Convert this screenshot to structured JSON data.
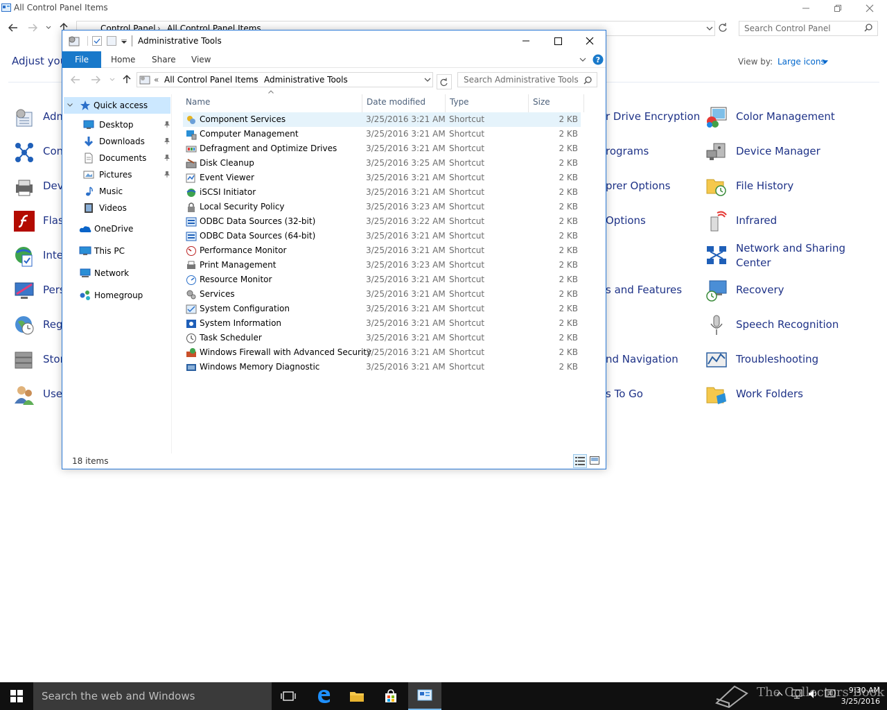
{
  "cp": {
    "title": "All Control Panel Items",
    "breadcrumb": [
      "Control Panel",
      "All Control Panel Items"
    ],
    "search_placeholder": "Search Control Panel",
    "adjust_label": "Adjust your computer's settings",
    "view_by_label": "View by:",
    "view_by_value": "Large icons",
    "left_items": [
      "Adm",
      "Con",
      "Dev",
      "Flas",
      "Inte",
      "Pers",
      "Reg",
      "Stor",
      "Use"
    ],
    "middle_items": [
      "r Drive Encryption",
      "rograms",
      "prer Options",
      "Options",
      "s and Features",
      "nd Navigation",
      "s To Go"
    ],
    "right_items": [
      "Color Management",
      "Device Manager",
      "File History",
      "Infrared",
      "Network and Sharing Center",
      "Recovery",
      "Speech Recognition",
      "Troubleshooting",
      "Work Folders"
    ]
  },
  "at": {
    "title": "Administrative Tools",
    "ribbon_tabs": [
      "File",
      "Home",
      "Share",
      "View"
    ],
    "breadcrumb": [
      "All Control Panel Items",
      "Administrative Tools"
    ],
    "breadcrumb_prefix": "«",
    "search_placeholder": "Search Administrative Tools",
    "nav": {
      "quick_access": "Quick access",
      "pinned": [
        "Desktop",
        "Downloads",
        "Documents",
        "Pictures"
      ],
      "unpinned": [
        "Music",
        "Videos"
      ],
      "roots": [
        "OneDrive",
        "This PC",
        "Network",
        "Homegroup"
      ]
    },
    "columns": [
      "Name",
      "Date modified",
      "Type",
      "Size"
    ],
    "files": [
      {
        "name": "Component Services",
        "date": "3/25/2016 3:21 AM",
        "type": "Shortcut",
        "size": "2 KB"
      },
      {
        "name": "Computer Management",
        "date": "3/25/2016 3:21 AM",
        "type": "Shortcut",
        "size": "2 KB"
      },
      {
        "name": "Defragment and Optimize Drives",
        "date": "3/25/2016 3:21 AM",
        "type": "Shortcut",
        "size": "2 KB"
      },
      {
        "name": "Disk Cleanup",
        "date": "3/25/2016 3:25 AM",
        "type": "Shortcut",
        "size": "2 KB"
      },
      {
        "name": "Event Viewer",
        "date": "3/25/2016 3:21 AM",
        "type": "Shortcut",
        "size": "2 KB"
      },
      {
        "name": "iSCSI Initiator",
        "date": "3/25/2016 3:21 AM",
        "type": "Shortcut",
        "size": "2 KB"
      },
      {
        "name": "Local Security Policy",
        "date": "3/25/2016 3:23 AM",
        "type": "Shortcut",
        "size": "2 KB"
      },
      {
        "name": "ODBC Data Sources (32-bit)",
        "date": "3/25/2016 3:22 AM",
        "type": "Shortcut",
        "size": "2 KB"
      },
      {
        "name": "ODBC Data Sources (64-bit)",
        "date": "3/25/2016 3:21 AM",
        "type": "Shortcut",
        "size": "2 KB"
      },
      {
        "name": "Performance Monitor",
        "date": "3/25/2016 3:21 AM",
        "type": "Shortcut",
        "size": "2 KB"
      },
      {
        "name": "Print Management",
        "date": "3/25/2016 3:23 AM",
        "type": "Shortcut",
        "size": "2 KB"
      },
      {
        "name": "Resource Monitor",
        "date": "3/25/2016 3:21 AM",
        "type": "Shortcut",
        "size": "2 KB"
      },
      {
        "name": "Services",
        "date": "3/25/2016 3:21 AM",
        "type": "Shortcut",
        "size": "2 KB"
      },
      {
        "name": "System Configuration",
        "date": "3/25/2016 3:21 AM",
        "type": "Shortcut",
        "size": "2 KB"
      },
      {
        "name": "System Information",
        "date": "3/25/2016 3:21 AM",
        "type": "Shortcut",
        "size": "2 KB"
      },
      {
        "name": "Task Scheduler",
        "date": "3/25/2016 3:21 AM",
        "type": "Shortcut",
        "size": "2 KB"
      },
      {
        "name": "Windows Firewall with Advanced Security",
        "date": "3/25/2016 3:21 AM",
        "type": "Shortcut",
        "size": "2 KB"
      },
      {
        "name": "Windows Memory Diagnostic",
        "date": "3/25/2016 3:21 AM",
        "type": "Shortcut",
        "size": "2 KB"
      }
    ],
    "status": "18 items"
  },
  "taskbar": {
    "search_placeholder": "Search the web and Windows",
    "time": "9:30 AM",
    "date": "3/25/2016",
    "watermark": "The Collectors Book"
  },
  "colors": {
    "accent": "#1979ca",
    "link": "#1e3287",
    "window_border": "#2b79d6",
    "selection": "#e5f3fb",
    "taskbar": "#101010"
  }
}
